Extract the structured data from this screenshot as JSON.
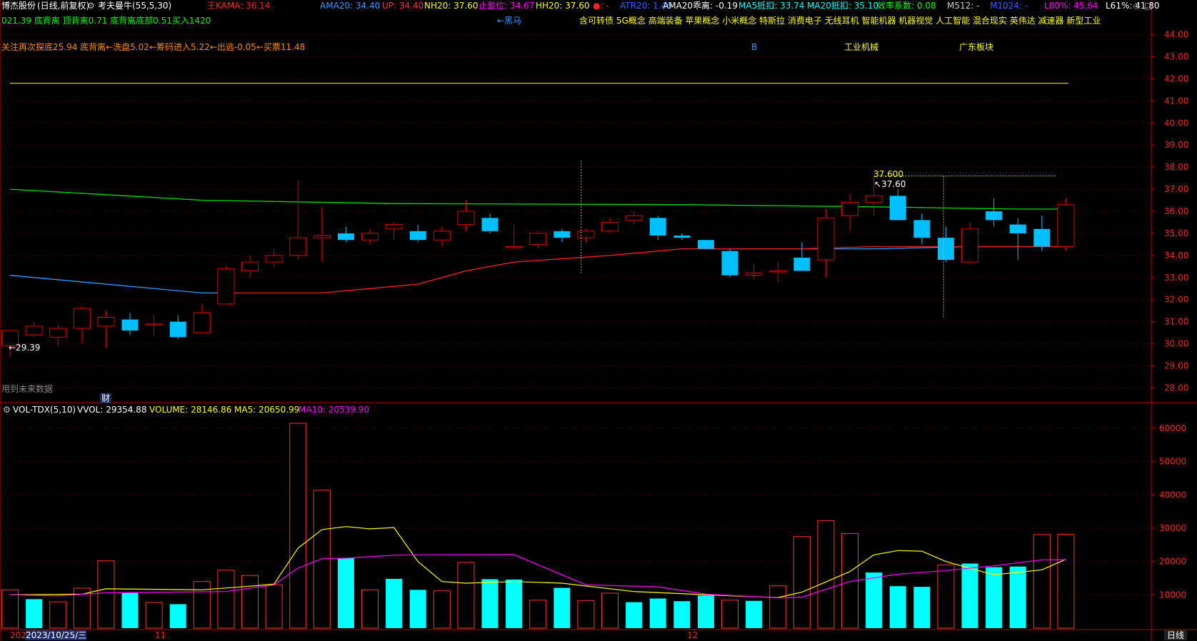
{
  "header": {
    "title": "博杰股份",
    "period": "(日线,前复权)",
    "indicator_name": "考夫曼牛(55,5,30)",
    "kama_label": "王KAMA: 36.14",
    "ama20": "AMA20: 34.40",
    "up": "UP: 34.40",
    "nh20": "NH20: 37.60",
    "stop_profit": "止盈位: 34.67",
    "hh20": "HH20: 37.60",
    "dot_label": "●: -",
    "atr20": "ATR20: 1.46",
    "ama20_deviation": "AMA20乖离: -0.19",
    "ma5_offset": "MA5抵扣: 33.74",
    "ma20_offset": "MA20抵扣: 35.10",
    "efficiency": "效率系数: 0.08",
    "m512": "M512: -",
    "m1024": "M1024: -",
    "l80": "L80%: 45.64",
    "l61": "L61%: 41.80",
    "diamond_icon": "◇",
    "square_icon": "□"
  },
  "line2": {
    "left": "021.39 底背离  顶背离0.71 底背离底部0.51买入1420",
    "dark_horse": "←黑马",
    "concepts": "含可转债 5G概念 高端装备 苹果概念 小米概念 特斯拉 消费电子 无线耳机 智能机器 机器视觉 人工智能 混合现实 英伟达 减速器 新型工业"
  },
  "line3": {
    "left": "关注再次探底25.94 底背离←洗盘5.02←筹码进入5.22←出逃-0.05←买票11.48",
    "b_label": "B",
    "industry": "工业机械",
    "region": "广东板块"
  },
  "annotations": {
    "high_label": "37.600",
    "high_arrow": "↖37.60",
    "low_arrow": "←29.39",
    "future_data": "用到未来数据",
    "finance_badge": "财"
  },
  "volume_panel": {
    "title": "VOL-TDX(5,10)",
    "vvol": "VVOL: 29354.88",
    "volume": "VOLUME: 28146.86",
    "ma5": "MA5: 20650.99",
    "ma10": "MA10: 20539.90",
    "gear_icon": "⚙"
  },
  "x_axis": {
    "start_year": "202",
    "date_cursor": "2023/10/25/三",
    "month_11": "11",
    "month_12": "12"
  },
  "period_tab": "日线",
  "colors": {
    "up": "#e00000",
    "down": "#00c0ff",
    "ma_green": "#00e000",
    "ma_blue": "#3399ff",
    "ma_red": "#ff2020",
    "vol_up": "#ff3030",
    "vol_down": "#00ffff",
    "ma5_vol": "#ffff00",
    "ma10_vol": "#ff00ff",
    "axis": "#c00000",
    "label_yellow": "#ffff00"
  },
  "chart_data": [
    {
      "type": "candlestick",
      "price_axis_ticks": [
        28.0,
        29.0,
        30.0,
        31.0,
        32.0,
        33.0,
        34.0,
        35.0,
        36.0,
        37.0,
        38.0,
        39.0,
        40.0,
        41.0,
        42.0,
        43.0,
        44.0
      ],
      "ylim": [
        27.4,
        44.6
      ],
      "reference_line": 41.8,
      "candles": [
        {
          "o": 29.9,
          "h": 30.4,
          "l": 29.39,
          "c": 30.6
        },
        {
          "o": 30.4,
          "h": 31.0,
          "l": 30.3,
          "c": 30.8
        },
        {
          "o": 30.3,
          "h": 30.9,
          "l": 29.9,
          "c": 30.7
        },
        {
          "o": 30.7,
          "h": 31.7,
          "l": 30.0,
          "c": 31.6
        },
        {
          "o": 30.8,
          "h": 31.5,
          "l": 29.8,
          "c": 31.2
        },
        {
          "o": 31.1,
          "h": 31.4,
          "l": 30.4,
          "c": 30.6
        },
        {
          "o": 30.9,
          "h": 31.3,
          "l": 30.4,
          "c": 30.9
        },
        {
          "o": 31.0,
          "h": 31.3,
          "l": 30.2,
          "c": 30.3
        },
        {
          "o": 30.5,
          "h": 31.8,
          "l": 30.5,
          "c": 31.4
        },
        {
          "o": 31.8,
          "h": 33.5,
          "l": 31.8,
          "c": 33.4
        },
        {
          "o": 33.3,
          "h": 34.0,
          "l": 33.0,
          "c": 33.7
        },
        {
          "o": 33.7,
          "h": 34.3,
          "l": 33.5,
          "c": 34.0
        },
        {
          "o": 34.0,
          "h": 37.4,
          "l": 33.8,
          "c": 34.8
        },
        {
          "o": 34.8,
          "h": 36.2,
          "l": 33.7,
          "c": 34.9
        },
        {
          "o": 35.0,
          "h": 35.3,
          "l": 34.6,
          "c": 34.7
        },
        {
          "o": 34.7,
          "h": 35.2,
          "l": 34.5,
          "c": 35.0
        },
        {
          "o": 35.2,
          "h": 35.5,
          "l": 34.7,
          "c": 35.4
        },
        {
          "o": 35.1,
          "h": 35.4,
          "l": 34.6,
          "c": 34.7
        },
        {
          "o": 34.7,
          "h": 35.3,
          "l": 34.4,
          "c": 35.1
        },
        {
          "o": 35.4,
          "h": 36.5,
          "l": 35.1,
          "c": 36.0
        },
        {
          "o": 35.7,
          "h": 35.9,
          "l": 35.0,
          "c": 35.1
        },
        {
          "o": 34.4,
          "h": 35.4,
          "l": 34.4,
          "c": 34.4
        },
        {
          "o": 34.5,
          "h": 35.1,
          "l": 34.3,
          "c": 35.0
        },
        {
          "o": 35.1,
          "h": 35.2,
          "l": 34.6,
          "c": 34.8
        },
        {
          "o": 34.8,
          "h": 35.2,
          "l": 34.6,
          "c": 35.1
        },
        {
          "o": 35.1,
          "h": 35.7,
          "l": 35.0,
          "c": 35.5
        },
        {
          "o": 35.6,
          "h": 36.0,
          "l": 35.4,
          "c": 35.8
        },
        {
          "o": 35.7,
          "h": 35.8,
          "l": 34.7,
          "c": 34.9
        },
        {
          "o": 34.9,
          "h": 35.0,
          "l": 34.7,
          "c": 34.8
        },
        {
          "o": 34.7,
          "h": 34.7,
          "l": 34.4,
          "c": 34.3
        },
        {
          "o": 34.2,
          "h": 34.3,
          "l": 33.0,
          "c": 33.1
        },
        {
          "o": 33.1,
          "h": 33.6,
          "l": 32.9,
          "c": 33.2
        },
        {
          "o": 33.3,
          "h": 33.7,
          "l": 32.8,
          "c": 33.3
        },
        {
          "o": 33.9,
          "h": 34.6,
          "l": 33.3,
          "c": 33.3
        },
        {
          "o": 33.8,
          "h": 36.1,
          "l": 33.0,
          "c": 35.7
        },
        {
          "o": 35.8,
          "h": 36.8,
          "l": 35.1,
          "c": 36.4
        },
        {
          "o": 36.4,
          "h": 37.6,
          "l": 35.8,
          "c": 36.7
        },
        {
          "o": 36.7,
          "h": 37.0,
          "l": 35.6,
          "c": 35.6
        },
        {
          "o": 35.6,
          "h": 35.9,
          "l": 34.5,
          "c": 34.8
        },
        {
          "o": 34.8,
          "h": 35.3,
          "l": 33.7,
          "c": 33.8
        },
        {
          "o": 33.7,
          "h": 35.5,
          "l": 33.6,
          "c": 35.2
        },
        {
          "o": 36.0,
          "h": 36.6,
          "l": 35.3,
          "c": 35.6
        },
        {
          "o": 35.4,
          "h": 35.7,
          "l": 33.8,
          "c": 35.0
        },
        {
          "o": 35.2,
          "h": 35.8,
          "l": 34.2,
          "c": 34.4
        },
        {
          "o": 34.4,
          "h": 36.6,
          "l": 34.2,
          "c": 36.3
        }
      ],
      "lines": [
        {
          "name": "",
          "color": "#00e000",
          "values": [
            [
              0,
              37.0
            ],
            [
              8,
              36.5
            ],
            [
              16,
              36.35
            ],
            [
              28,
              36.3
            ],
            [
              36,
              36.2
            ],
            [
              42,
              36.1
            ],
            [
              44,
              36.1
            ]
          ]
        },
        {
          "name": "",
          "color": "#3399ff",
          "values": [
            [
              0,
              33.1
            ],
            [
              8,
              32.3
            ],
            [
              9,
              32.3
            ],
            [
              9,
              null
            ],
            [
              29,
              34.3
            ],
            [
              36,
              34.3
            ],
            [
              40,
              34.4
            ],
            [
              44,
              34.4
            ]
          ]
        },
        {
          "name": "",
          "color": "#ff2020",
          "values": [
            [
              9,
              32.3
            ],
            [
              13,
              32.3
            ],
            [
              17,
              32.7
            ],
            [
              19,
              33.3
            ],
            [
              21,
              33.7
            ],
            [
              25,
              34.0
            ],
            [
              28,
              34.3
            ],
            [
              33,
              34.3
            ],
            [
              36,
              34.4
            ],
            [
              44,
              34.4
            ]
          ]
        }
      ]
    },
    {
      "type": "bar",
      "title": "VOL-TDX(5,10)",
      "ylim": [
        0,
        66000
      ],
      "y_ticks": [
        10000,
        20000,
        30000,
        40000,
        50000,
        60000
      ],
      "volumes": [
        11500,
        8700,
        7900,
        12000,
        20200,
        10600,
        7700,
        7200,
        14000,
        17400,
        15800,
        13000,
        61500,
        41400,
        21100,
        11500,
        14800,
        11500,
        11200,
        19700,
        14700,
        14600,
        8400,
        12100,
        8300,
        10500,
        7800,
        8900,
        8100,
        9800,
        8400,
        8200,
        12700,
        27500,
        32300,
        28400,
        16700,
        12600,
        12400,
        19000,
        19400,
        18300,
        18500,
        28100,
        28146.86
      ],
      "up_flags": [
        1,
        0,
        1,
        1,
        1,
        0,
        1,
        0,
        1,
        1,
        1,
        1,
        1,
        1,
        0,
        1,
        0,
        0,
        1,
        1,
        0,
        0,
        1,
        0,
        1,
        1,
        0,
        0,
        0,
        0,
        1,
        0,
        1,
        1,
        1,
        1,
        0,
        0,
        0,
        1,
        0,
        0,
        0,
        1,
        1
      ],
      "ma5": [
        [
          0,
          10000
        ],
        [
          3,
          10200
        ],
        [
          4,
          11800
        ],
        [
          8,
          11500
        ],
        [
          10,
          12600
        ],
        [
          11,
          13200
        ],
        [
          12,
          24000
        ],
        [
          13,
          29600
        ],
        [
          14,
          30500
        ],
        [
          15,
          29800
        ],
        [
          16,
          30200
        ],
        [
          17,
          20000
        ],
        [
          18,
          14000
        ],
        [
          19,
          13500
        ],
        [
          21,
          14000
        ],
        [
          23,
          13500
        ],
        [
          26,
          11000
        ],
        [
          30,
          9700
        ],
        [
          32,
          9200
        ],
        [
          33,
          10800
        ],
        [
          35,
          17000
        ],
        [
          36,
          22000
        ],
        [
          37,
          23300
        ],
        [
          38,
          23100
        ],
        [
          39,
          20000
        ],
        [
          41,
          16000
        ],
        [
          43,
          17500
        ],
        [
          44,
          20650.99
        ]
      ],
      "ma10": [
        [
          0,
          10000
        ],
        [
          2,
          9700
        ],
        [
          4,
          10600
        ],
        [
          9,
          11000
        ],
        [
          11,
          13000
        ],
        [
          12,
          18000
        ],
        [
          13,
          20800
        ],
        [
          14,
          21000
        ],
        [
          16,
          21900
        ],
        [
          17,
          22000
        ],
        [
          21,
          22100
        ],
        [
          22,
          19000
        ],
        [
          23,
          16000
        ],
        [
          24,
          13000
        ],
        [
          27,
          12400
        ],
        [
          29,
          10200
        ],
        [
          32,
          9100
        ],
        [
          33,
          9300
        ],
        [
          35,
          14000
        ],
        [
          37,
          16200
        ],
        [
          39,
          17300
        ],
        [
          41,
          18700
        ],
        [
          43,
          20500
        ],
        [
          44,
          20539.9
        ]
      ]
    }
  ]
}
